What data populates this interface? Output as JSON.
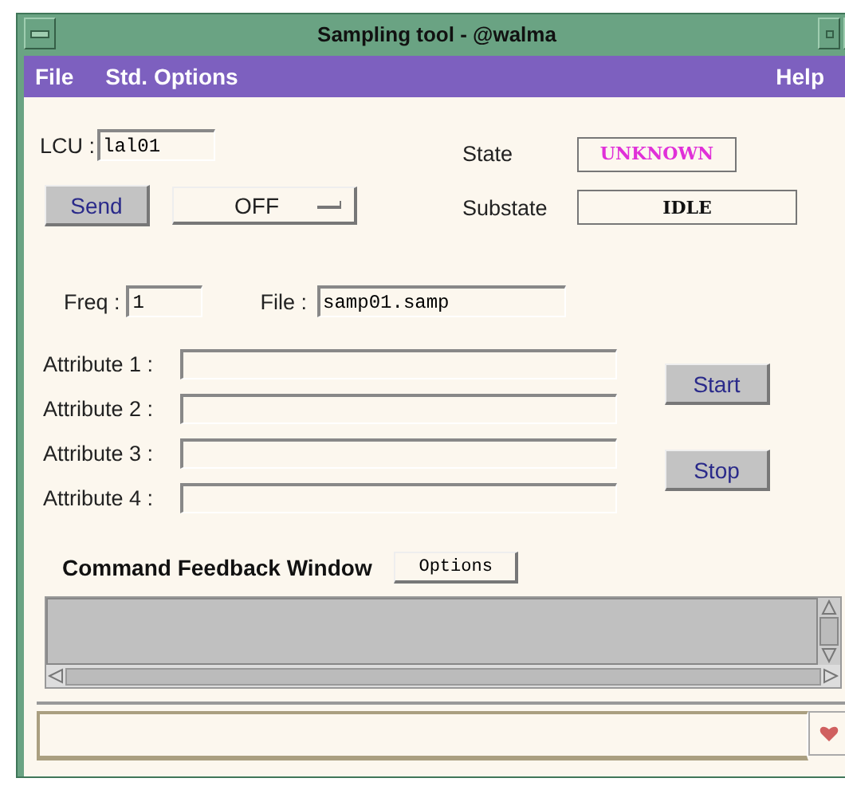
{
  "window": {
    "title": "Sampling tool - @walma"
  },
  "menu_left": [
    "File",
    "Std. Options"
  ],
  "menu_right": "Help",
  "lcu": {
    "label": "LCU :",
    "value": "lal01"
  },
  "send_button": "Send",
  "mode_dropdown": {
    "value": "OFF"
  },
  "state": {
    "label": "State",
    "value": "UNKNOWN"
  },
  "substate": {
    "label": "Substate",
    "value": "IDLE"
  },
  "freq": {
    "label": "Freq :",
    "value": "1"
  },
  "file": {
    "label": "File :",
    "value": "samp01.samp"
  },
  "attributes": [
    {
      "label": "Attribute 1 :"
    },
    {
      "label": "Attribute 2 :"
    },
    {
      "label": "Attribute 3 :"
    },
    {
      "label": "Attribute 4 :"
    }
  ],
  "start_button": "Start",
  "stop_button": "Stop",
  "feedback": {
    "title": "Command Feedback Window",
    "options_button": "Options"
  }
}
